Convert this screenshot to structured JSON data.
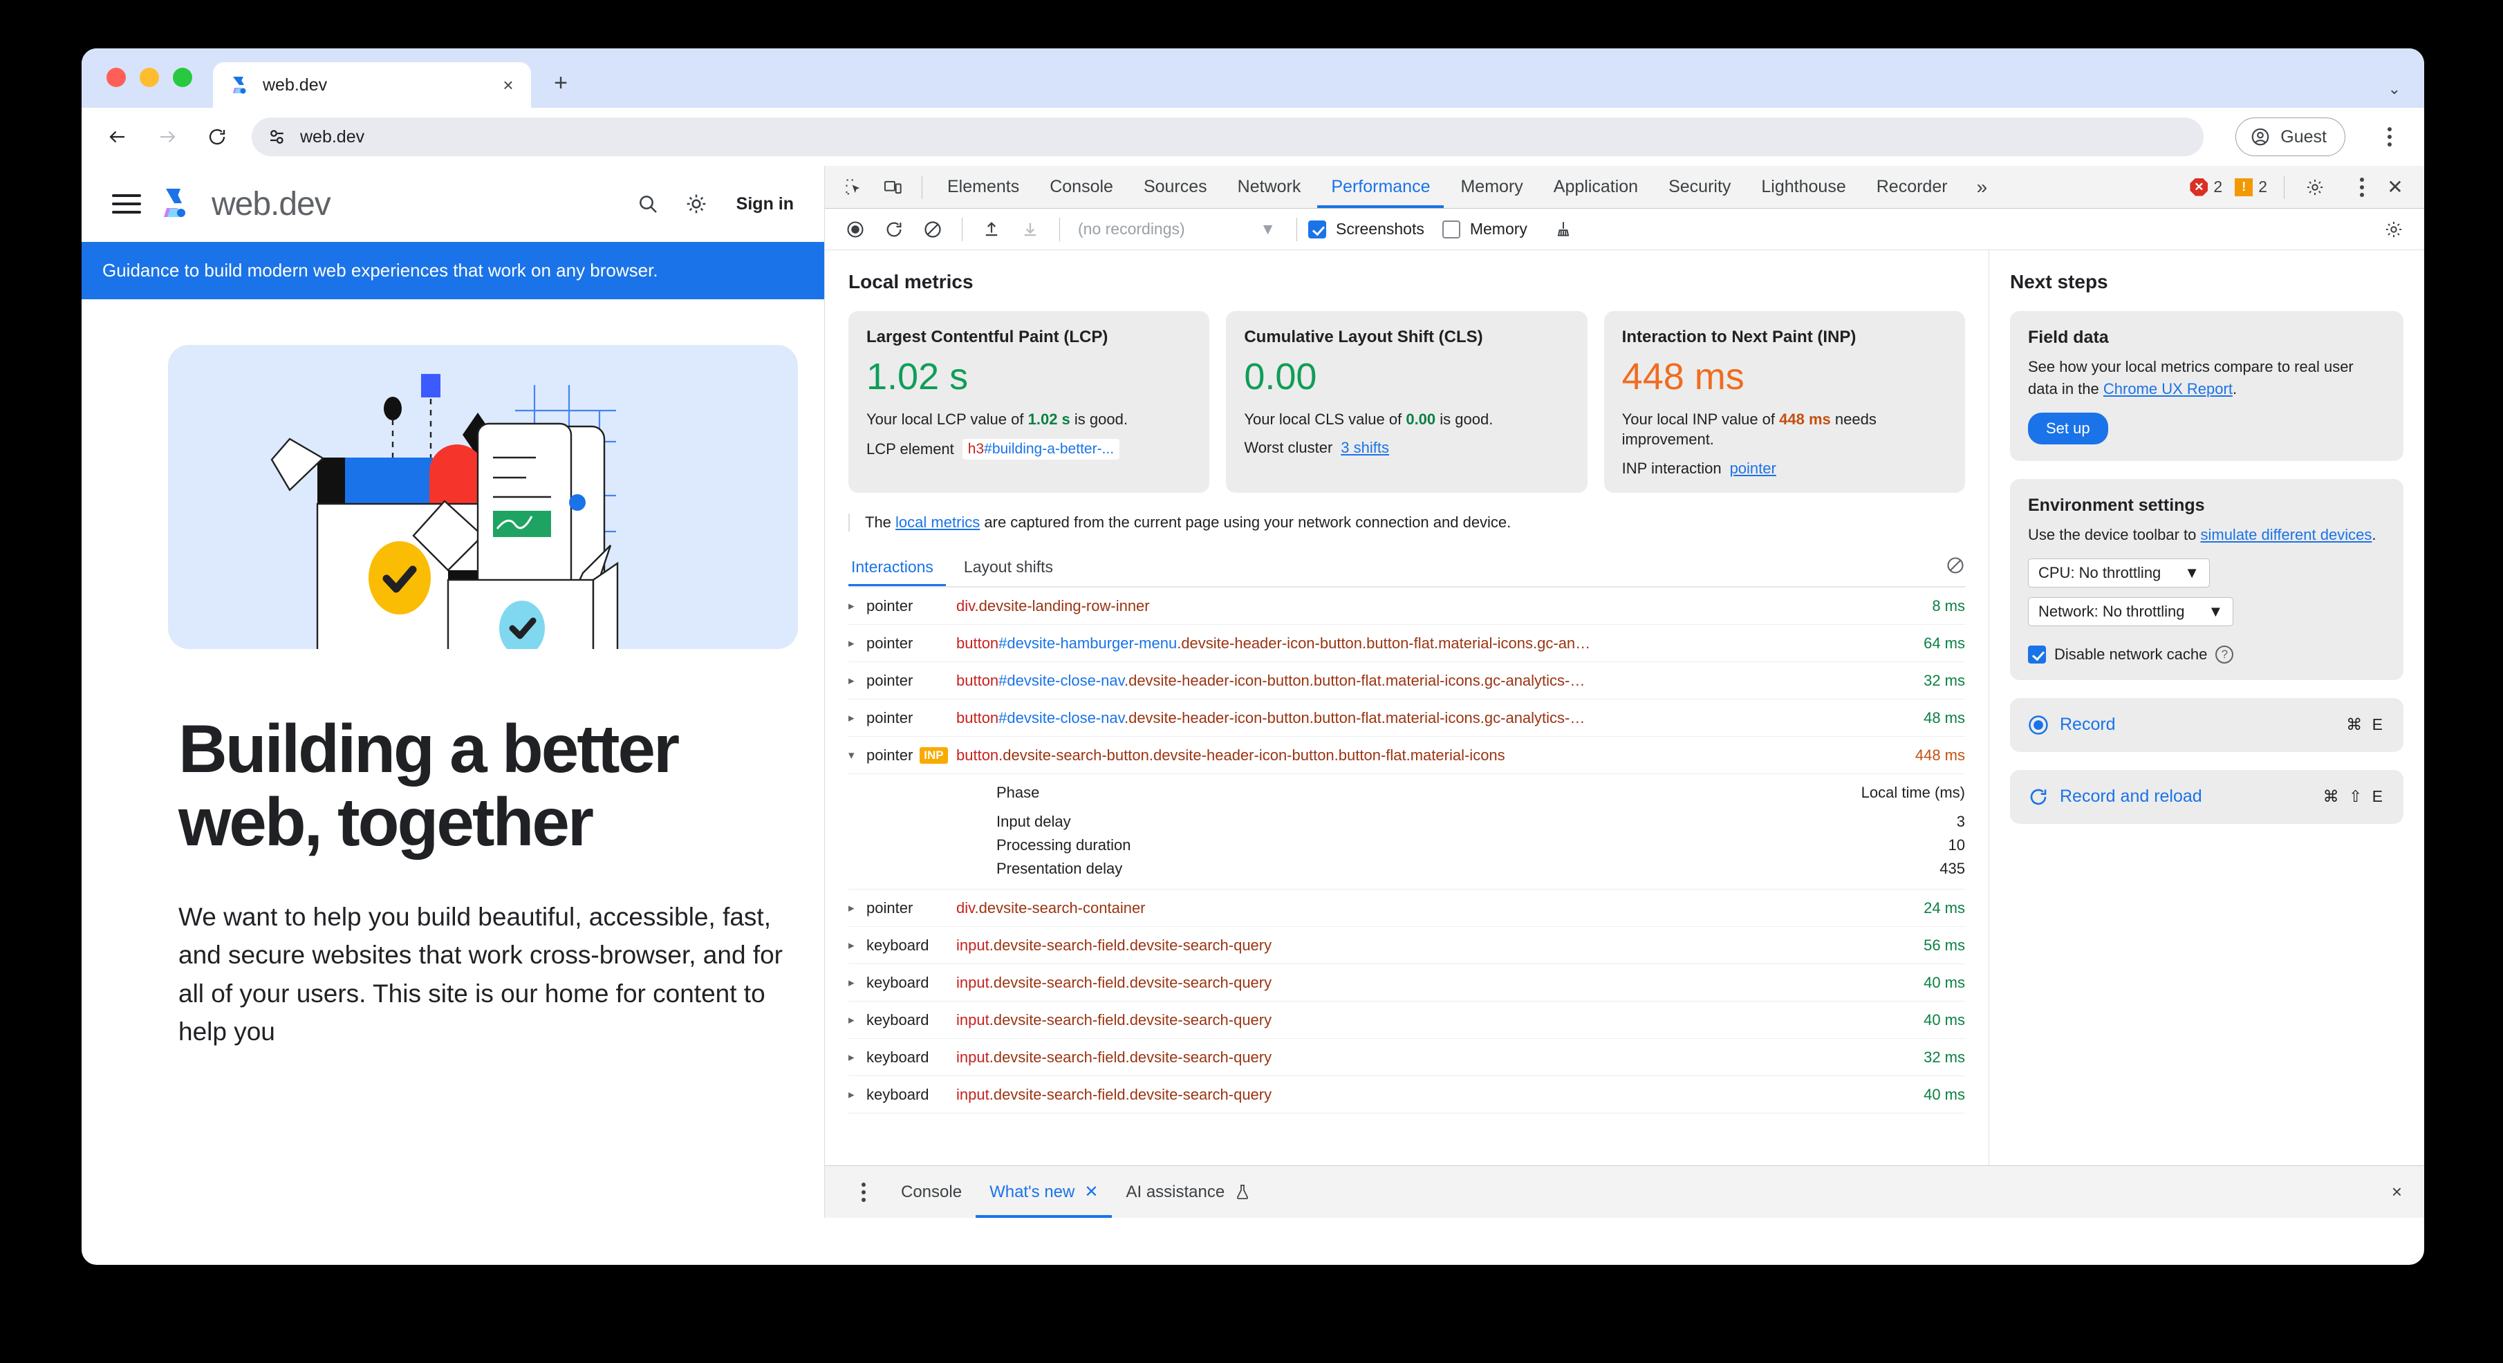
{
  "browser": {
    "tab": {
      "title": "web.dev",
      "favicon": "webdev-logo-icon",
      "close": "×"
    },
    "new_tab": "+",
    "tabstrip_chevron": "⌄",
    "back": "←",
    "forward": "→",
    "reload": "⟳",
    "url": "web.dev",
    "site_info_icon": "tune-icon",
    "profile_label": "Guest"
  },
  "page": {
    "brand": "web.dev",
    "sign_in": "Sign in",
    "banner": "Guidance to build modern web experiences that work on any browser.",
    "heading": "Building a better web, together",
    "paragraph": "We want to help you build beautiful, accessible, fast, and secure websites that work cross-browser, and for all of your users. This site is our home for content to help you"
  },
  "devtools": {
    "tabs": [
      {
        "label": "Elements",
        "active": false
      },
      {
        "label": "Console",
        "active": false
      },
      {
        "label": "Sources",
        "active": false
      },
      {
        "label": "Network",
        "active": false
      },
      {
        "label": "Performance",
        "active": true
      },
      {
        "label": "Memory",
        "active": false
      },
      {
        "label": "Application",
        "active": false
      },
      {
        "label": "Security",
        "active": false
      },
      {
        "label": "Lighthouse",
        "active": false
      },
      {
        "label": "Recorder",
        "active": false
      }
    ],
    "more_tabs": "»",
    "error_count": "2",
    "warning_count": "2",
    "settings_icon": "gear-icon",
    "menu_icon": "kebab-icon",
    "close_icon": "close-icon",
    "toolbar": {
      "record_icon": "record-icon",
      "reload_icon": "record-and-reload-icon",
      "clear_icon": "clear-icon",
      "upload_icon": "upload-profile-icon",
      "download_icon": "download-profile-icon",
      "recordings_value": "(no recordings)",
      "screenshots_label": "Screenshots",
      "screenshots_checked": true,
      "memory_label": "Memory",
      "memory_checked": false,
      "collect_garbage_icon": "broom-icon",
      "capture_settings_icon": "capture-settings-icon"
    },
    "local_metrics_title": "Local metrics",
    "metrics": [
      {
        "title": "Largest Contentful Paint (LCP)",
        "value": "1.02 s",
        "state": "good",
        "desc_pre": "Your local LCP value of ",
        "desc_value": "1.02 s",
        "desc_post": " is good.",
        "row_label": "LCP element",
        "chip_tag": "h3",
        "chip_rest": "#building-a-better-...",
        "chip_kind": "selector"
      },
      {
        "title": "Cumulative Layout Shift (CLS)",
        "value": "0.00",
        "state": "good",
        "desc_pre": "Your local CLS value of ",
        "desc_value": "0.00",
        "desc_post": " is good.",
        "row_label": "Worst cluster",
        "link": "3 shifts",
        "chip_kind": "link"
      },
      {
        "title": "Interaction to Next Paint (INP)",
        "value": "448 ms",
        "state": "needs",
        "desc_pre": "Your local INP value of ",
        "desc_value": "448 ms",
        "desc_post": " needs improvement.",
        "row_label": "INP interaction",
        "link": "pointer",
        "chip_kind": "link"
      }
    ],
    "note": {
      "pre": "The ",
      "link": "local metrics",
      "post": " are captured from the current page using your network connection and device."
    },
    "subtabs": [
      {
        "label": "Interactions",
        "active": true
      },
      {
        "label": "Layout shifts",
        "active": false
      }
    ],
    "clear_interactions_icon": "clear-icon",
    "interactions": [
      {
        "arrow": "▸",
        "type": "pointer",
        "inp": false,
        "tag": "div",
        "id": "",
        "classes": ".devsite-landing-row-inner",
        "time": "8 ms",
        "warn": false,
        "expanded": false
      },
      {
        "arrow": "▸",
        "type": "pointer",
        "inp": false,
        "tag": "button",
        "id": "#devsite-hamburger-menu",
        "classes": ".devsite-header-icon-button.button-flat.material-icons.gc-an…",
        "time": "64 ms",
        "warn": false,
        "expanded": false
      },
      {
        "arrow": "▸",
        "type": "pointer",
        "inp": false,
        "tag": "button",
        "id": "#devsite-close-nav",
        "classes": ".devsite-header-icon-button.button-flat.material-icons.gc-analytics-…",
        "time": "32 ms",
        "warn": false,
        "expanded": false
      },
      {
        "arrow": "▸",
        "type": "pointer",
        "inp": false,
        "tag": "button",
        "id": "#devsite-close-nav",
        "classes": ".devsite-header-icon-button.button-flat.material-icons.gc-analytics-…",
        "time": "48 ms",
        "warn": false,
        "expanded": false
      },
      {
        "arrow": "▾",
        "type": "pointer",
        "inp": true,
        "inp_badge": "INP",
        "tag": "button",
        "id": "",
        "classes": ".devsite-search-button.devsite-header-icon-button.button-flat.material-icons",
        "time": "448 ms",
        "warn": true,
        "expanded": true
      },
      {
        "arrow": "▸",
        "type": "pointer",
        "inp": false,
        "tag": "div",
        "id": "",
        "classes": ".devsite-search-container",
        "time": "24 ms",
        "warn": false,
        "expanded": false
      },
      {
        "arrow": "▸",
        "type": "keyboard",
        "inp": false,
        "tag": "input",
        "id": "",
        "classes": ".devsite-search-field.devsite-search-query",
        "time": "56 ms",
        "warn": false,
        "expanded": false
      },
      {
        "arrow": "▸",
        "type": "keyboard",
        "inp": false,
        "tag": "input",
        "id": "",
        "classes": ".devsite-search-field.devsite-search-query",
        "time": "40 ms",
        "warn": false,
        "expanded": false
      },
      {
        "arrow": "▸",
        "type": "keyboard",
        "inp": false,
        "tag": "input",
        "id": "",
        "classes": ".devsite-search-field.devsite-search-query",
        "time": "40 ms",
        "warn": false,
        "expanded": false
      },
      {
        "arrow": "▸",
        "type": "keyboard",
        "inp": false,
        "tag": "input",
        "id": "",
        "classes": ".devsite-search-field.devsite-search-query",
        "time": "32 ms",
        "warn": false,
        "expanded": false
      },
      {
        "arrow": "▸",
        "type": "keyboard",
        "inp": false,
        "tag": "input",
        "id": "",
        "classes": ".devsite-search-field.devsite-search-query",
        "time": "40 ms",
        "warn": false,
        "expanded": false
      }
    ],
    "phase_table": {
      "head_phase": "Phase",
      "head_time": "Local time (ms)",
      "rows": [
        {
          "name": "Input delay",
          "value": "3"
        },
        {
          "name": "Processing duration",
          "value": "10"
        },
        {
          "name": "Presentation delay",
          "value": "435"
        }
      ]
    },
    "next_steps": {
      "title": "Next steps",
      "field_data": {
        "heading": "Field data",
        "text_pre": "See how your local metrics compare to real user data in the ",
        "link": "Chrome UX Report",
        "text_post": ".",
        "button": "Set up"
      },
      "environment": {
        "heading": "Environment settings",
        "text_pre": "Use the device toolbar to ",
        "link": "simulate different devices",
        "text_post": ".",
        "cpu_value": "CPU: No throttling",
        "network_value": "Network: No throttling",
        "disable_cache_label": "Disable network cache",
        "disable_cache_checked": true,
        "help_icon": "question-icon",
        "chevron": "▼"
      },
      "record": {
        "label": "Record",
        "shortcut": "⌘ E",
        "icon": "record-icon"
      },
      "record_reload": {
        "label": "Record and reload",
        "shortcut": "⌘ ⇧ E",
        "icon": "reload-icon"
      }
    },
    "drawer": {
      "menu_icon": "kebab-icon",
      "tabs": [
        {
          "label": "Console",
          "active": false,
          "closable": false,
          "flask": false
        },
        {
          "label": "What's new",
          "active": true,
          "closable": true,
          "flask": false
        },
        {
          "label": "AI assistance",
          "active": false,
          "closable": false,
          "flask": true
        }
      ],
      "close": "×"
    }
  }
}
